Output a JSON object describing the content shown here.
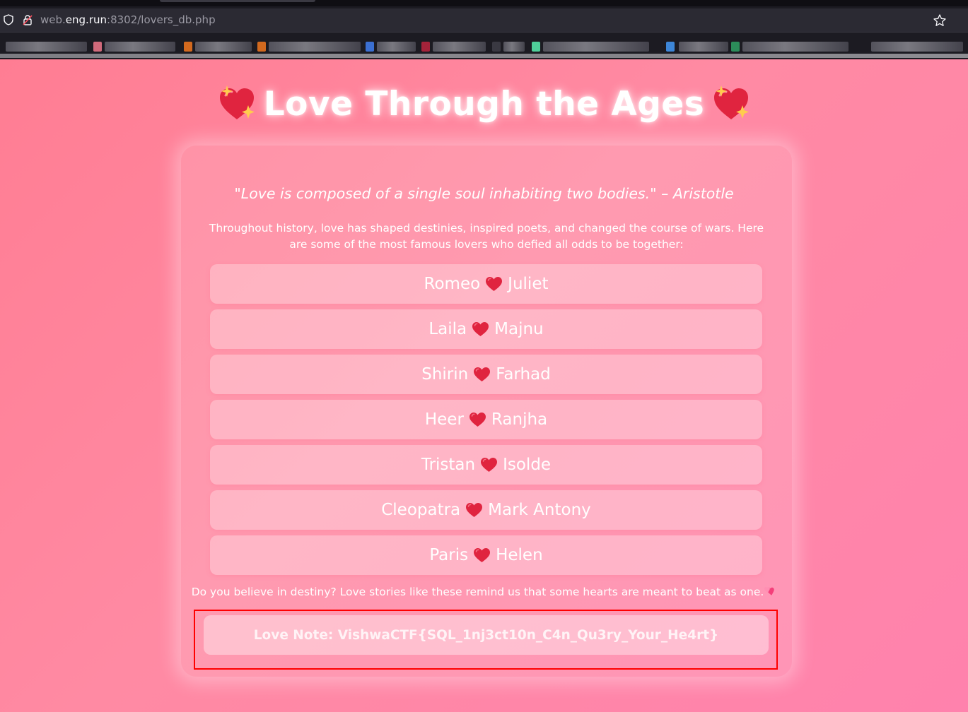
{
  "browser": {
    "url_prefix": "web.",
    "url_domain": "eng.run",
    "url_rest": ":8302/lovers_db.php"
  },
  "page": {
    "title": "Love Through the Ages",
    "title_icon": "sparkling-heart",
    "quote": "\"Love is composed of a single soul inhabiting two bodies.\" – Aristotle",
    "intro": "Throughout history, love has shaped destinies, inspired poets, and changed the course of wars. Here are some of the most famous lovers who defied all odds to be together:",
    "lovers": [
      {
        "a": "Romeo",
        "b": "Juliet"
      },
      {
        "a": "Laila",
        "b": "Majnu"
      },
      {
        "a": "Shirin",
        "b": "Farhad"
      },
      {
        "a": "Heer",
        "b": "Ranjha"
      },
      {
        "a": "Tristan",
        "b": "Isolde"
      },
      {
        "a": "Cleopatra",
        "b": "Mark Antony"
      },
      {
        "a": "Paris",
        "b": "Helen"
      }
    ],
    "outro": "Do you believe in destiny? Love stories like these remind us that some hearts are meant to beat as one.",
    "love_note": "Love Note: VishwaCTF{SQL_1nj3ct10n_C4n_Qu3ry_Your_He4rt}"
  },
  "colors": {
    "background": "#ff8aa3",
    "heart": "#e0243f",
    "highlight": "#ff0000"
  }
}
